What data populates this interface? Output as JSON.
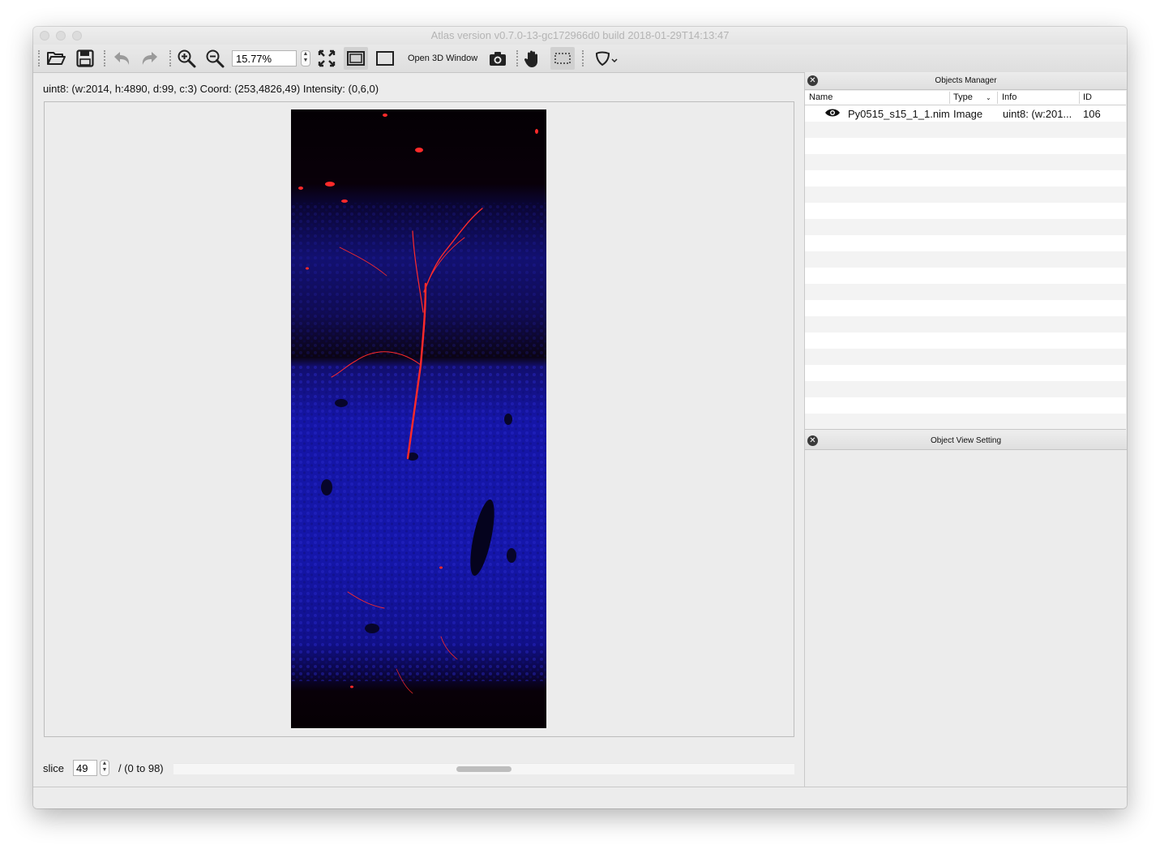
{
  "window": {
    "title": "Atlas version v0.7.0-13-gc172966d0 build 2018-01-29T14:13:47"
  },
  "toolbar": {
    "zoom_value": "15.77%",
    "open_3d_label": "Open 3D Window",
    "icons": [
      "open-folder-icon",
      "save-icon",
      "undo-icon",
      "redo-icon",
      "zoom-in-icon",
      "zoom-out-icon",
      "fit-to-window-icon",
      "frame-view-icon",
      "original-size-icon",
      "camera-icon",
      "hand-pan-icon",
      "rect-select-icon",
      "shield-dropdown-icon"
    ]
  },
  "image_info": "uint8: (w:2014, h:4890, d:99, c:3) Coord: (253,4826,49) Intensity: (0,6,0)",
  "slice": {
    "label": "slice",
    "value": "49",
    "range": "/ (0 to 98)",
    "position_fraction": 0.5
  },
  "objects_manager": {
    "title": "Objects Manager",
    "columns": [
      "Name",
      "Type",
      "Info",
      "ID"
    ],
    "rows": [
      {
        "name": "Py0515_s15_1_1.nim",
        "type": "Image",
        "info": "uint8: (w:201...",
        "id": "106",
        "visible": true
      }
    ]
  },
  "object_view_setting": {
    "title": "Object View Setting"
  },
  "colors": {
    "stripe": "#f3f3f3",
    "nuclei_blue": "#1516aa",
    "neuron_red": "#ff2a2a"
  }
}
